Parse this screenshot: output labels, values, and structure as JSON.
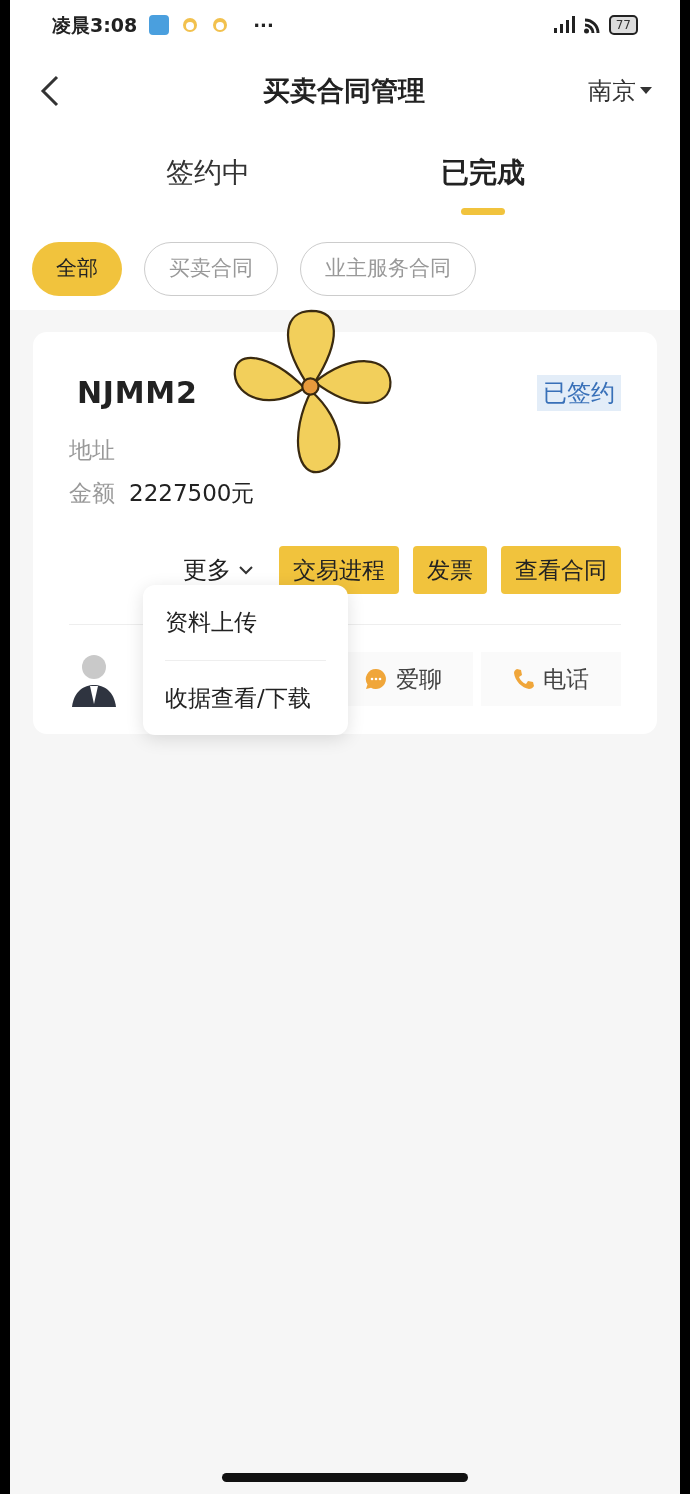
{
  "status_bar": {
    "time": "凌晨3:08",
    "more": "···",
    "battery": "77"
  },
  "nav": {
    "title": "买卖合同管理",
    "city": "南京"
  },
  "tabs": [
    {
      "label": "签约中",
      "selected": false
    },
    {
      "label": "已完成",
      "selected": true
    }
  ],
  "filters": [
    {
      "label": "全部",
      "selected": true
    },
    {
      "label": "买卖合同",
      "selected": false
    },
    {
      "label": "业主服务合同",
      "selected": false
    }
  ],
  "contract": {
    "code": "NJMM2",
    "status": "已签约",
    "address_label": "地址",
    "amount_label": "金额",
    "amount": "2227500元",
    "more": {
      "label": "更多",
      "expanded": true,
      "items": [
        "资料上传",
        "收据查看/下载"
      ]
    },
    "actions": [
      "交易进程",
      "发票",
      "查看合同"
    ],
    "contacts": [
      {
        "kind": "chat",
        "label": "爱聊"
      },
      {
        "kind": "phone",
        "label": "电话"
      }
    ]
  }
}
